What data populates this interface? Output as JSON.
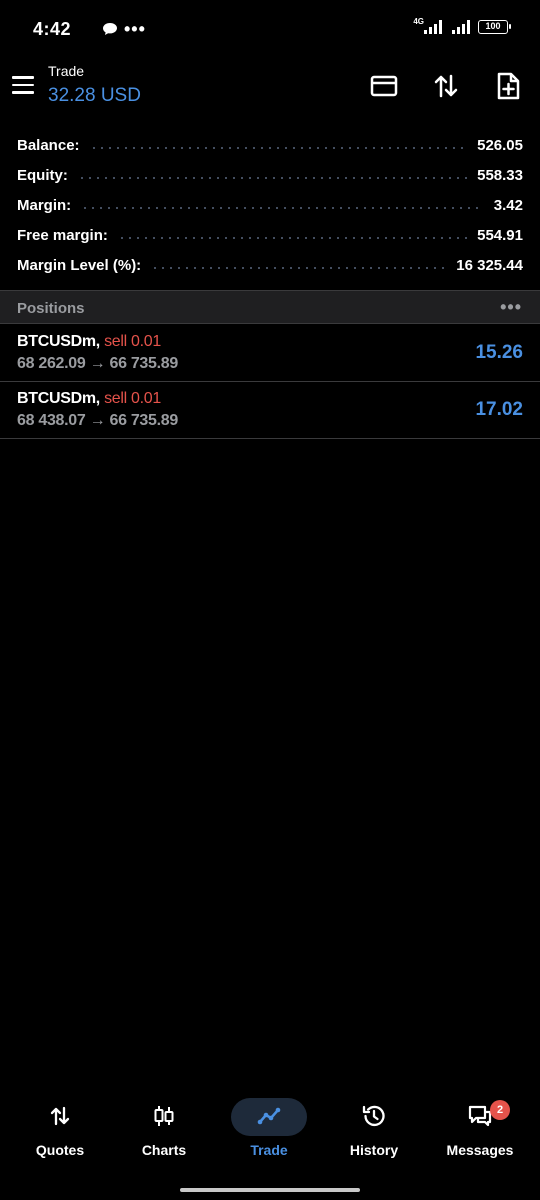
{
  "status_bar": {
    "time": "4:42",
    "network": "4G",
    "battery": "100"
  },
  "header": {
    "title": "Trade",
    "subtitle": "32.28 USD"
  },
  "summary": [
    {
      "label": "Balance:",
      "value": "526.05"
    },
    {
      "label": "Equity:",
      "value": "558.33"
    },
    {
      "label": "Margin:",
      "value": "3.42"
    },
    {
      "label": "Free margin:",
      "value": "554.91"
    },
    {
      "label": "Margin Level (%):",
      "value": "16 325.44"
    }
  ],
  "positions": {
    "title": "Positions",
    "items": [
      {
        "symbol": "BTCUSDm,",
        "side": "sell 0.01",
        "prices": "68 262.09 → 66 735.89",
        "profit": "15.26"
      },
      {
        "symbol": "BTCUSDm,",
        "side": "sell 0.01",
        "prices": "68 438.07 → 66 735.89",
        "profit": "17.02"
      }
    ]
  },
  "nav": [
    {
      "label": "Quotes",
      "icon": "quotes-icon"
    },
    {
      "label": "Charts",
      "icon": "charts-icon"
    },
    {
      "label": "Trade",
      "icon": "trade-icon",
      "active": true
    },
    {
      "label": "History",
      "icon": "history-icon"
    },
    {
      "label": "Messages",
      "icon": "messages-icon",
      "badge": "2"
    }
  ],
  "colors": {
    "accent": "#4a90e2",
    "sell": "#e5534b",
    "muted": "#9a9ca0",
    "background": "#000000"
  }
}
